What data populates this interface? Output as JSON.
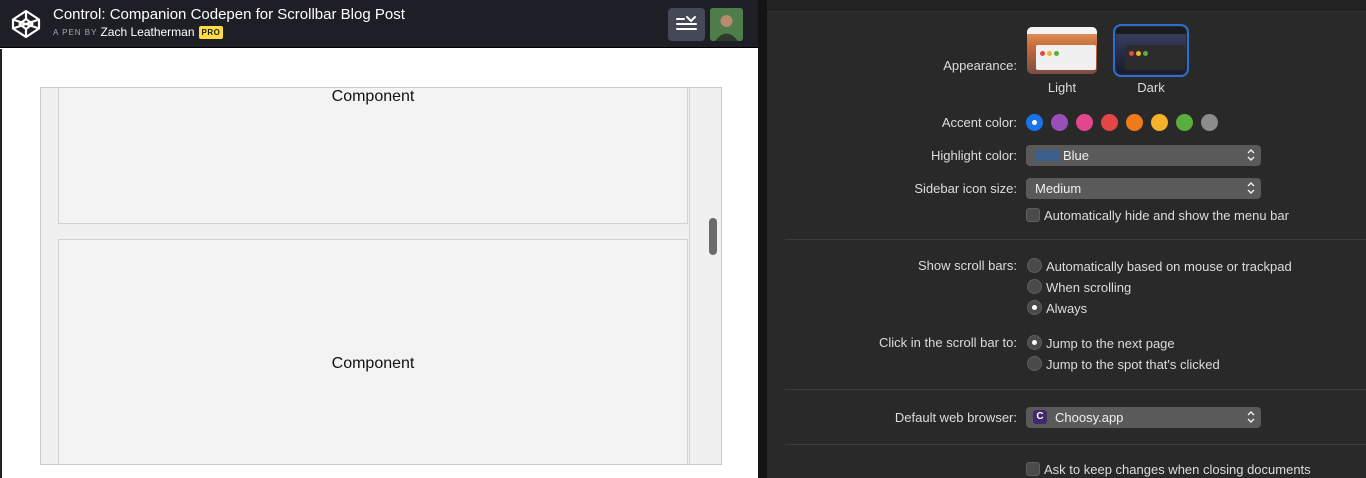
{
  "codepen": {
    "title": "Control: Companion Codepen for Scrollbar Blog Post",
    "by_prefix": "A PEN BY",
    "author": "Zach Leatherman",
    "author_badge": "PRO",
    "components": [
      {
        "label": "Component"
      },
      {
        "label": "Component"
      }
    ]
  },
  "prefs": {
    "appearance": {
      "label": "Appearance:",
      "options": [
        {
          "label": "Light",
          "selected": false
        },
        {
          "label": "Dark",
          "selected": true
        }
      ]
    },
    "accent_color": {
      "label": "Accent color:",
      "swatches": [
        {
          "name": "blue",
          "color": "#1a73e8",
          "selected": true
        },
        {
          "name": "purple",
          "color": "#9a4fb8",
          "selected": false
        },
        {
          "name": "pink",
          "color": "#e2478c",
          "selected": false
        },
        {
          "name": "red",
          "color": "#e64545",
          "selected": false
        },
        {
          "name": "orange",
          "color": "#ef7a1c",
          "selected": false
        },
        {
          "name": "yellow",
          "color": "#f4b328",
          "selected": false
        },
        {
          "name": "green",
          "color": "#5aae3d",
          "selected": false
        },
        {
          "name": "graphite",
          "color": "#8c8c8c",
          "selected": false
        }
      ]
    },
    "highlight_color": {
      "label": "Highlight color:",
      "value": "Blue",
      "swatch": "#3a5f8c"
    },
    "sidebar_icon_size": {
      "label": "Sidebar icon size:",
      "value": "Medium"
    },
    "menu_bar": {
      "label": "Automatically hide and show the menu bar",
      "checked": false
    },
    "show_scroll_bars": {
      "label": "Show scroll bars:",
      "options": [
        {
          "label": "Automatically based on mouse or trackpad",
          "selected": false
        },
        {
          "label": "When scrolling",
          "selected": false
        },
        {
          "label": "Always",
          "selected": true
        }
      ]
    },
    "click_scroll_bar": {
      "label": "Click in the scroll bar to:",
      "options": [
        {
          "label": "Jump to the next page",
          "selected": true
        },
        {
          "label": "Jump to the spot that's clicked",
          "selected": false
        }
      ]
    },
    "default_browser": {
      "label": "Default web browser:",
      "value": "Choosy.app"
    },
    "ask_keep_changes": {
      "label": "Ask to keep changes when closing documents",
      "checked": false
    }
  }
}
